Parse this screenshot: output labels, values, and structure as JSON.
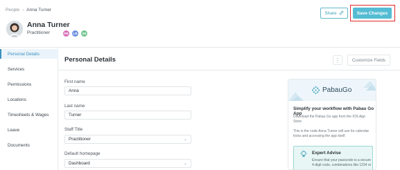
{
  "breadcrumb": {
    "parent": "People",
    "separator": "›",
    "current": "Anna Turner"
  },
  "profile": {
    "name": "Anna Turner",
    "role": "Practitioner",
    "badges": [
      {
        "label": "PB",
        "color": "#d86fb9"
      },
      {
        "label": "LB",
        "color": "#6c8fe0"
      },
      {
        "label": "SB",
        "color": "#6fc38c"
      }
    ]
  },
  "header": {
    "share_label": "Share",
    "save_label": "Save Changes"
  },
  "sidebar": {
    "items": [
      {
        "label": "Personal Details",
        "active": true
      },
      {
        "label": "Services"
      },
      {
        "label": "Permissions"
      },
      {
        "label": "Locations"
      },
      {
        "label": "Timesheets & Wages"
      },
      {
        "label": "Leave"
      },
      {
        "label": "Documents"
      }
    ]
  },
  "main": {
    "title": "Personal Details",
    "customize_label": "Customize Fields",
    "fields": [
      {
        "label": "First name",
        "value": "Anna"
      },
      {
        "label": "Last name",
        "value": "Turner"
      },
      {
        "label": "Staff Title",
        "value": "Practitioner"
      },
      {
        "label": "Default homepage",
        "value": "Dashboard"
      }
    ]
  },
  "promo": {
    "brand": "PabauGo",
    "title": "Simplify your workflow with Pabau Go App",
    "text1": "Download the Pabau Go app from the IOS App Store.",
    "text2": "This is the code Anna Turner will use for calendar locks and accessing the app itself.",
    "expert_title": "Expert Advise",
    "expert_text": "Ensure that your passcode is a secure 4-digit code, combinations like 1234 or"
  },
  "colors": {
    "accent": "#54bcd3",
    "highlight": "#e02a2a",
    "active_nav": "#3b8fbf"
  }
}
